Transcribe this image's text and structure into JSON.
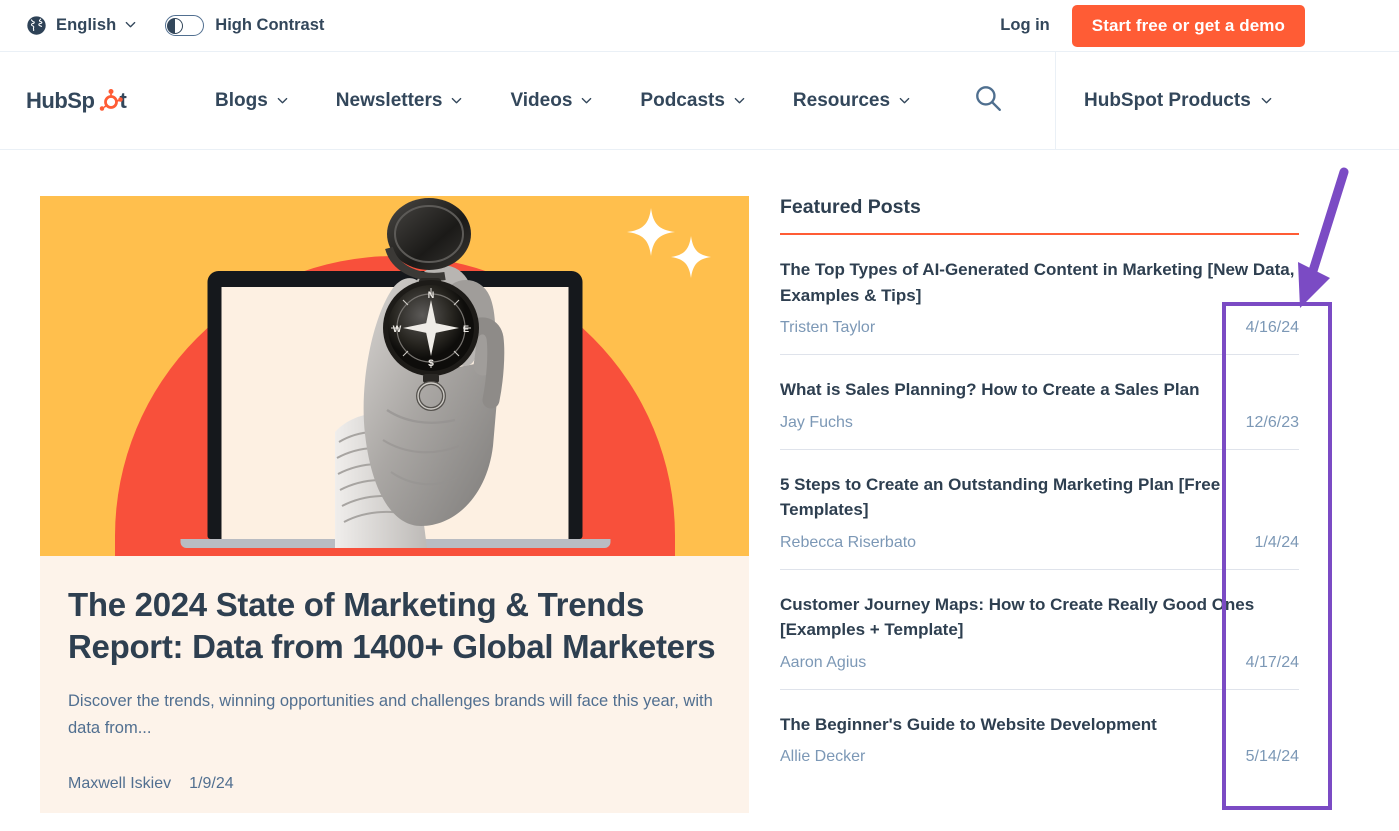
{
  "utility_bar": {
    "globe_icon": "globe-icon",
    "language": "English",
    "language_chevron": "chevron-down-icon",
    "contrast_toggle_icon": "contrast-toggle",
    "contrast_label": "High Contrast",
    "login_label": "Log in",
    "cta_label": "Start free or get a demo",
    "cta_color": "#ff5c35"
  },
  "main_nav": {
    "brand": "HubSpot",
    "items": [
      {
        "label": "Blogs",
        "chevron": "chevron-down-icon"
      },
      {
        "label": "Newsletters",
        "chevron": "chevron-down-icon"
      },
      {
        "label": "Videos",
        "chevron": "chevron-down-icon"
      },
      {
        "label": "Podcasts",
        "chevron": "chevron-down-icon"
      },
      {
        "label": "Resources",
        "chevron": "chevron-down-icon"
      }
    ],
    "search_icon": "search-icon",
    "products_label": "HubSpot Products",
    "products_chevron": "chevron-down-icon"
  },
  "hero": {
    "image_alt": "Hand holding a compass in front of a laptop",
    "bg_color": "#ffbf4d",
    "arch_color": "#f8503b",
    "card_color": "#fdf3ea",
    "title": "The 2024 State of Marketing & Trends Report: Data from 1400+ Global Marketers",
    "description": "Discover the trends, winning opportunities and challenges brands will face this year, with data from...",
    "author": "Maxwell Iskiev",
    "date": "1/9/24"
  },
  "featured": {
    "heading": "Featured Posts",
    "underline_color": "#ff5c35",
    "posts": [
      {
        "title": "The Top Types of AI-Generated Content in Marketing [New Data, Examples & Tips]",
        "author": "Tristen Taylor",
        "date": "4/16/24"
      },
      {
        "title": "What is Sales Planning? How to Create a Sales Plan",
        "author": "Jay Fuchs",
        "date": "12/6/23"
      },
      {
        "title": "5 Steps to Create an Outstanding Marketing Plan [Free Templates]",
        "author": "Rebecca Riserbato",
        "date": "1/4/24"
      },
      {
        "title": "Customer Journey Maps: How to Create Really Good Ones [Examples + Template]",
        "author": "Aaron Agius",
        "date": "4/17/24"
      },
      {
        "title": "The Beginner's Guide to Website Development",
        "author": "Allie Decker",
        "date": "5/14/24"
      }
    ]
  },
  "annotation": {
    "color": "#7b4bc4",
    "highlight_target": "post-dates-column",
    "arrow_icon": "arrow-down-left-icon"
  }
}
